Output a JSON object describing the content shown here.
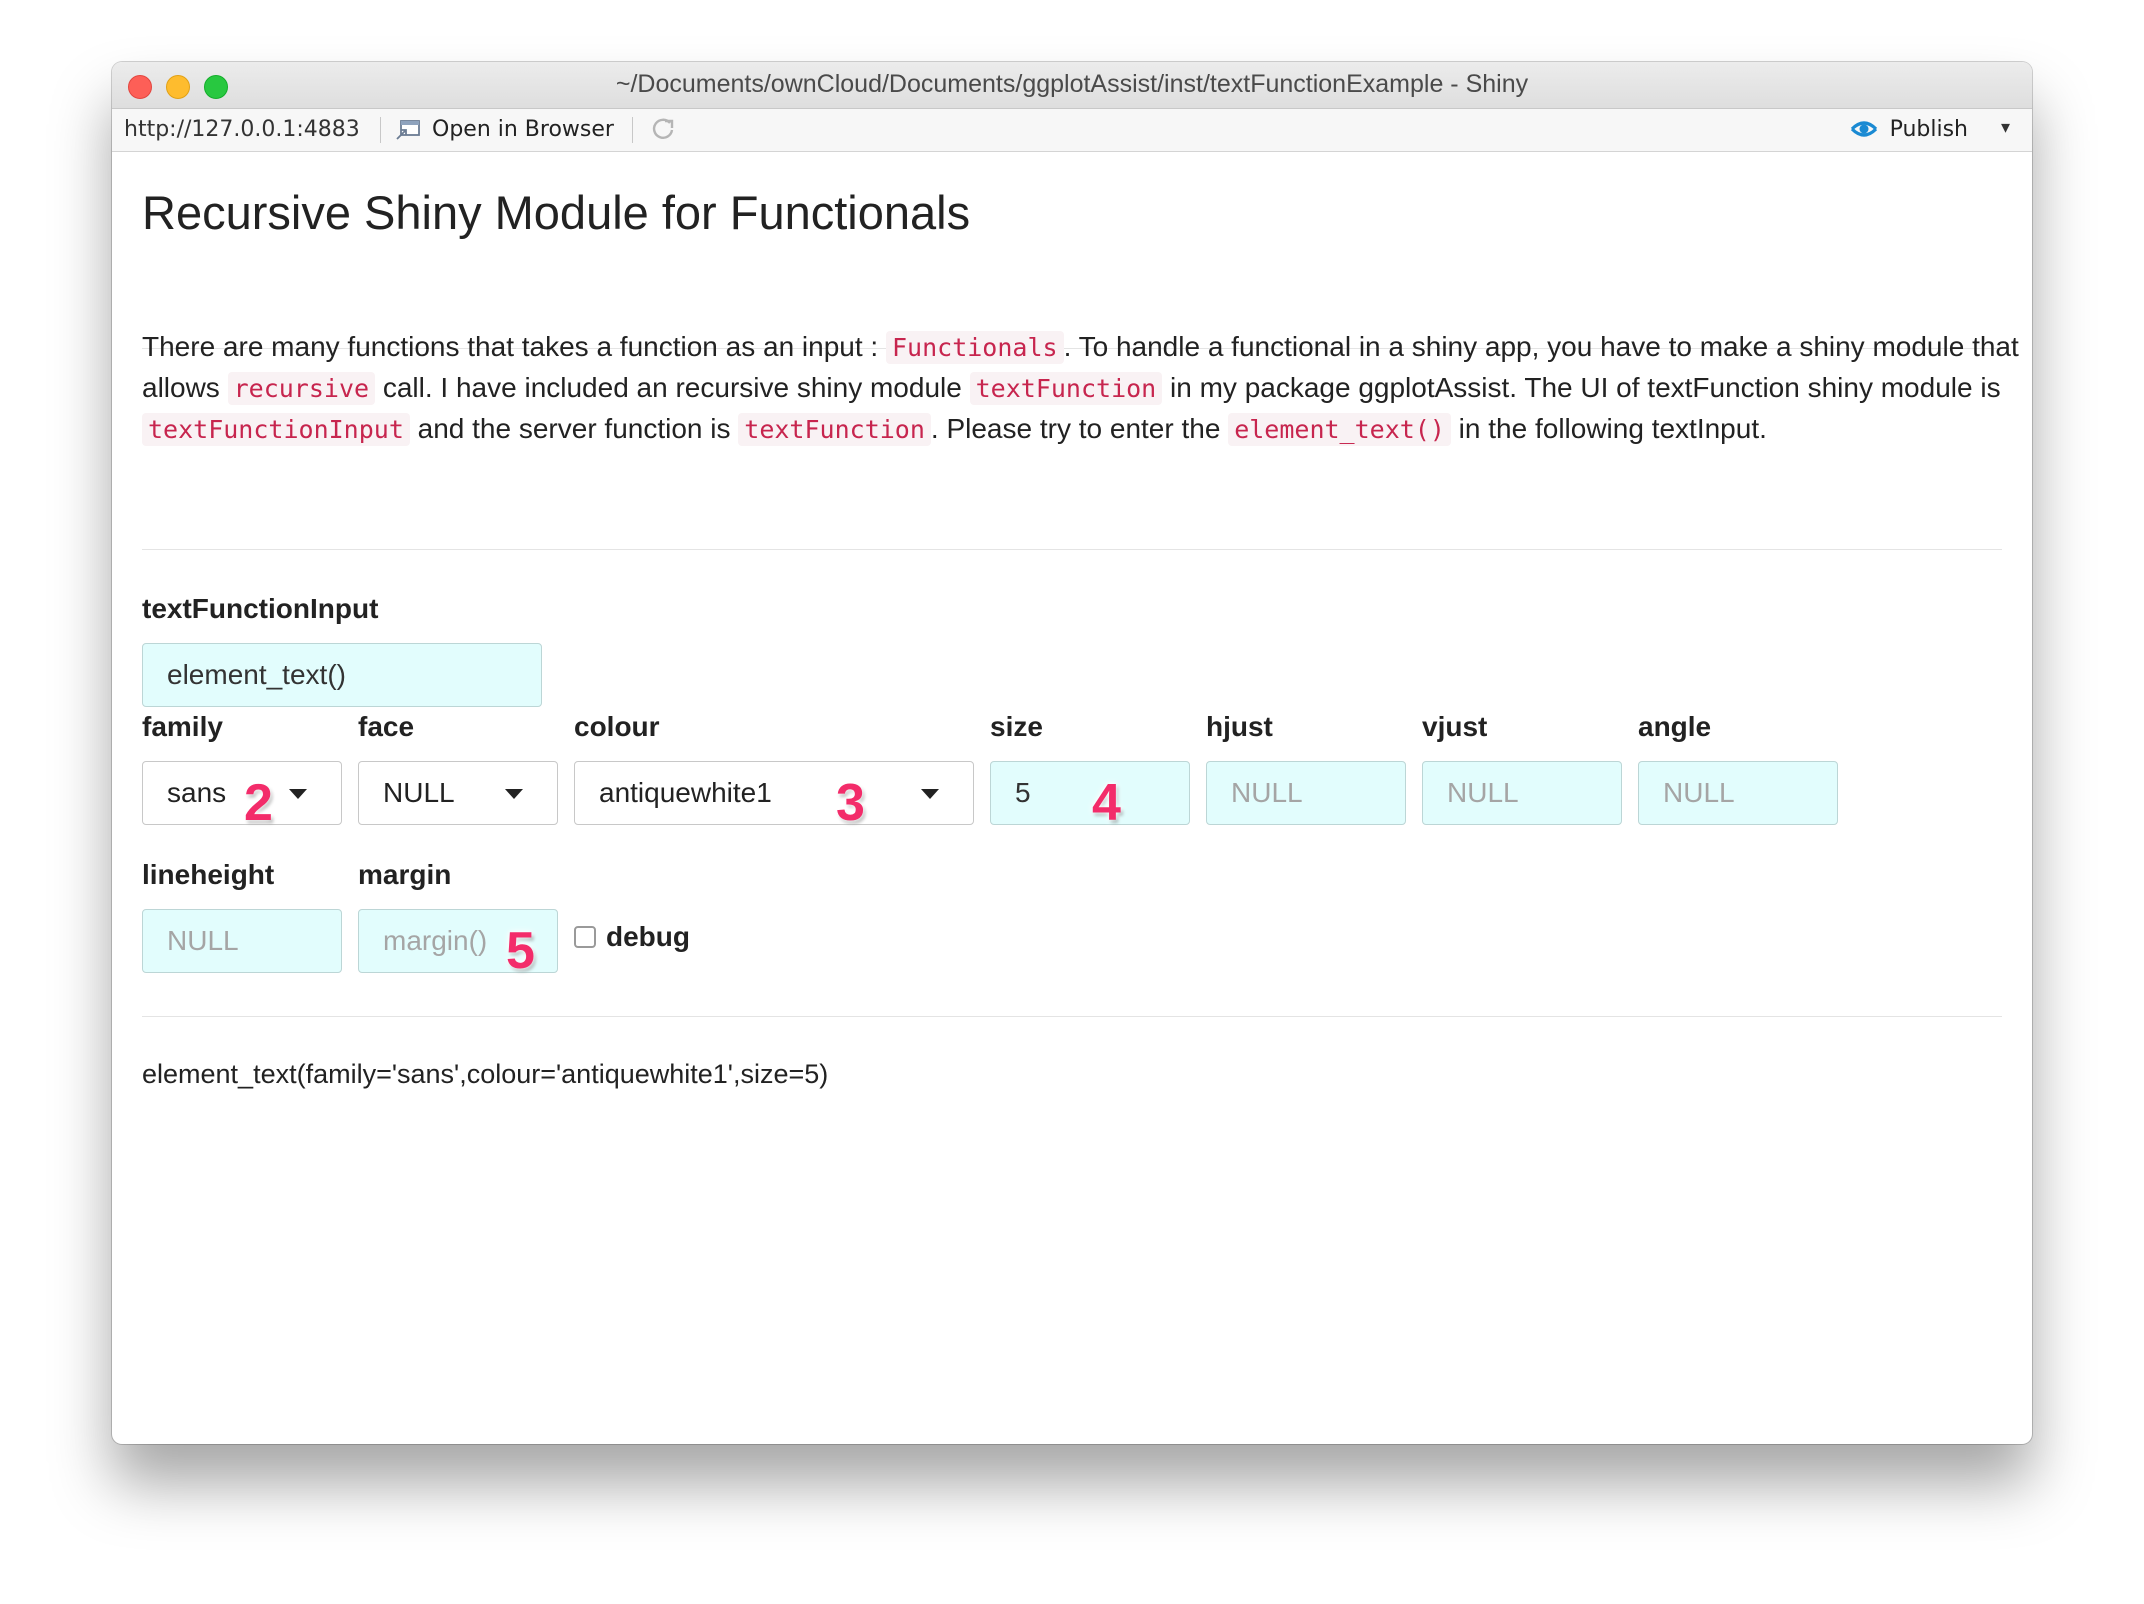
{
  "window": {
    "title": "~/Documents/ownCloud/Documents/ggplotAssist/inst/textFunctionExample - Shiny"
  },
  "toolbar": {
    "url": "http://127.0.0.1:4883",
    "open_in_browser": "Open in Browser",
    "publish": "Publish",
    "publish_icon": "publish-icon",
    "refresh_icon": "refresh-icon"
  },
  "page": {
    "title": "Recursive Shiny Module for Functionals",
    "paragraph": [
      {
        "text": "There are many functions that takes a function as an input : "
      },
      {
        "code": "Functionals"
      },
      {
        "text": ". To handle a functional in a shiny app, you have to make a shiny module that allows "
      },
      {
        "code": "recursive"
      },
      {
        "text": " call. I have included an recursive shiny module "
      },
      {
        "code": "textFunction"
      },
      {
        "text": " in my package ggplotAssist. The UI of textFunction shiny module is "
      },
      {
        "code": "textFunctionInput"
      },
      {
        "text": " and the server function is "
      },
      {
        "code": "textFunction"
      },
      {
        "text": ". Please try to enter the "
      },
      {
        "code": "element_text()"
      },
      {
        "text": " in the following textInput."
      }
    ]
  },
  "form": {
    "main_label": "textFunctionInput",
    "main_value": "element_text()",
    "family": {
      "label": "family",
      "value": "sans"
    },
    "face": {
      "label": "face",
      "value": "NULL"
    },
    "colour": {
      "label": "colour",
      "value": "antiquewhite1"
    },
    "size": {
      "label": "size",
      "value": "5"
    },
    "hjust": {
      "label": "hjust",
      "placeholder": "NULL"
    },
    "vjust": {
      "label": "vjust",
      "placeholder": "NULL"
    },
    "angle": {
      "label": "angle",
      "placeholder": "NULL"
    },
    "lineheight": {
      "label": "lineheight",
      "placeholder": "NULL"
    },
    "margin": {
      "label": "margin",
      "placeholder": "margin()"
    },
    "debug": {
      "label": "debug",
      "checked": false
    }
  },
  "annotations": [
    "2",
    "3",
    "4",
    "5"
  ],
  "output": {
    "text": "element_text(family='sans',colour='antiquewhite1',size=5)"
  },
  "colors": {
    "text_input_bg": "#e2fdfd",
    "code_fg": "#c7254e",
    "code_bg": "#f9f2f4",
    "badge": "#f32c6a",
    "publish_blue": "#1a8ad3"
  }
}
